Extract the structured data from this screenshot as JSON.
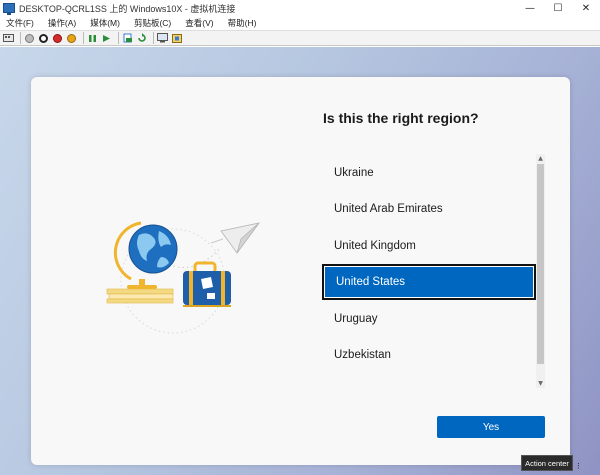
{
  "window": {
    "title": "DESKTOP-QCRL1SS 上的 Windows10X - 虚拟机连接",
    "minimize_glyph": "—",
    "maximize_glyph": "☐",
    "close_glyph": "✕"
  },
  "menu": {
    "items": [
      "文件(F)",
      "操作(A)",
      "媒体(M)",
      "剪贴板(C)",
      "查看(V)",
      "帮助(H)"
    ]
  },
  "toolbar": {
    "icons": [
      "ctrl-alt-del-icon",
      "start-icon",
      "turn-off-icon",
      "shutdown-icon",
      "save-icon",
      "pause-icon",
      "play-icon",
      "checkpoint-icon",
      "revert-icon",
      "enhanced-session-icon",
      "share-icon"
    ]
  },
  "oobe": {
    "heading": "Is this the right region?",
    "regions": [
      "Ukraine",
      "United Arab Emirates",
      "United Kingdom",
      "United States",
      "Uruguay",
      "Uzbekistan"
    ],
    "selected_region": "United States",
    "yes_label": "Yes",
    "accent_color": "#0067c0"
  },
  "tooltip": {
    "text": "Action center"
  }
}
